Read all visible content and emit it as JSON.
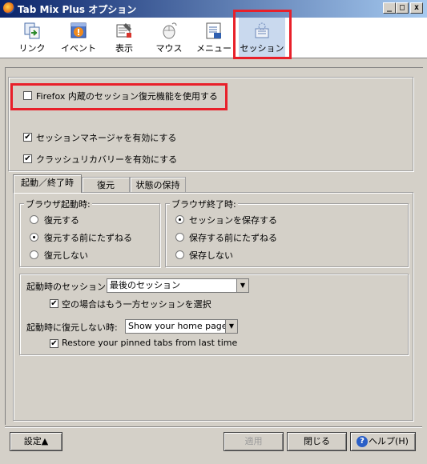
{
  "window": {
    "title": "Tab Mix Plus オプション",
    "minimize": "_",
    "maximize": "□",
    "close": "x"
  },
  "toolbar": {
    "items": [
      {
        "label": "リンク",
        "icon": "link-icon"
      },
      {
        "label": "イベント",
        "icon": "event-icon"
      },
      {
        "label": "表示",
        "icon": "display-icon"
      },
      {
        "label": "マウス",
        "icon": "mouse-icon"
      },
      {
        "label": "メニュー",
        "icon": "menu-icon"
      },
      {
        "label": "セッション",
        "icon": "session-icon",
        "selected": true
      }
    ]
  },
  "session": {
    "firefox_builtin": "Firefox 内蔵のセッション復元機能を使用する",
    "firefox_builtin_checked": false,
    "session_manager": "セッションマネージャを有効にする",
    "session_manager_checked": true,
    "crash_recovery": "クラッシュリカバリーを有効にする",
    "crash_recovery_checked": true
  },
  "tabs": [
    "起動／終了時",
    "復元",
    "状態の保持"
  ],
  "startup_group": {
    "legend": "ブラウザ起動時:",
    "options": [
      "復元する",
      "復元する前にたずねる",
      "復元しない"
    ],
    "selected": 1
  },
  "exit_group": {
    "legend": "ブラウザ終了時:",
    "options": [
      "セッションを保存する",
      "保存する前にたずねる",
      "保存しない"
    ],
    "selected": 0
  },
  "startup_session": {
    "label": "起動時のセッション:",
    "value": "最後のセッション",
    "empty_checkbox": "空の場合はもう一方セッションを選択",
    "empty_checked": true
  },
  "no_restore": {
    "label": "起動時に復元しない時:",
    "value": "Show your home page",
    "pinned_checkbox": "Restore your pinned tabs from last time",
    "pinned_checked": true
  },
  "footer": {
    "settings": "設定▲",
    "apply": "適用",
    "close": "閉じる",
    "help": "ヘルプ(H)"
  },
  "colors": {
    "highlight": "#e8202a",
    "titlebar": "#0a246a"
  }
}
